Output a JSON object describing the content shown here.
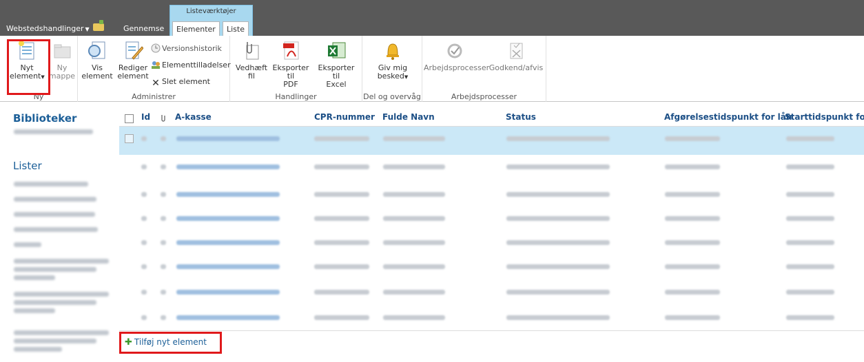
{
  "topbar": {
    "site_actions": "Webstedshandlinger",
    "context_group": "Listeværktøjer",
    "tabs": [
      "Gennemse",
      "Elementer",
      "Liste"
    ]
  },
  "ribbon": {
    "groups": [
      "Ny",
      "Administrer",
      "Handlinger",
      "Del og overvåg",
      "Arbejdsprocesser"
    ],
    "ny": {
      "nyt_element": [
        "Nyt",
        "element"
      ],
      "ny_mappe": [
        "Ny",
        "mappe"
      ]
    },
    "administrer": {
      "vis_element": [
        "Vis",
        "element"
      ],
      "rediger_element": [
        "Rediger",
        "element"
      ],
      "versionshistorik": "Versionshistorik",
      "elementtilladelser": "Elementtilladelser",
      "slet_element": "Slet element"
    },
    "handlinger": {
      "vedhaeft": [
        "Vedhæft",
        "fil"
      ],
      "pdf": [
        "Eksporter til",
        "PDF"
      ],
      "excel": [
        "Eksporter til",
        "Excel"
      ]
    },
    "del": {
      "giv_mig": [
        "Giv mig",
        "besked"
      ]
    },
    "arbejdsprocesser": {
      "arbejdsprocesser": "Arbejdsprocesser",
      "godkend": "Godkend/afvis"
    }
  },
  "leftnav": {
    "biblioteker": "Biblioteker",
    "lister": "Lister"
  },
  "table": {
    "columns": [
      "Id",
      "A-kasse",
      "CPR-nummer",
      "Fulde Navn",
      "Status",
      "Afgørelsestidspunkt for lån",
      "Starttidspunkt for u"
    ],
    "row_count": 8
  },
  "add_new": "Tilføj nyt element",
  "colors": {
    "topbar": "#595959",
    "context": "#a8d8ef",
    "link": "#1c5f98",
    "selected_row": "#cbe8f7",
    "highlight": "#e0191b"
  },
  "icons": [
    "new-item-icon",
    "new-folder-icon",
    "view-item-icon",
    "edit-item-icon",
    "version-history-icon",
    "permissions-icon",
    "delete-icon",
    "attach-icon",
    "pdf-icon",
    "excel-icon",
    "bell-icon",
    "workflow-icon",
    "approve-icon",
    "plus-icon",
    "paperclip-icon"
  ]
}
